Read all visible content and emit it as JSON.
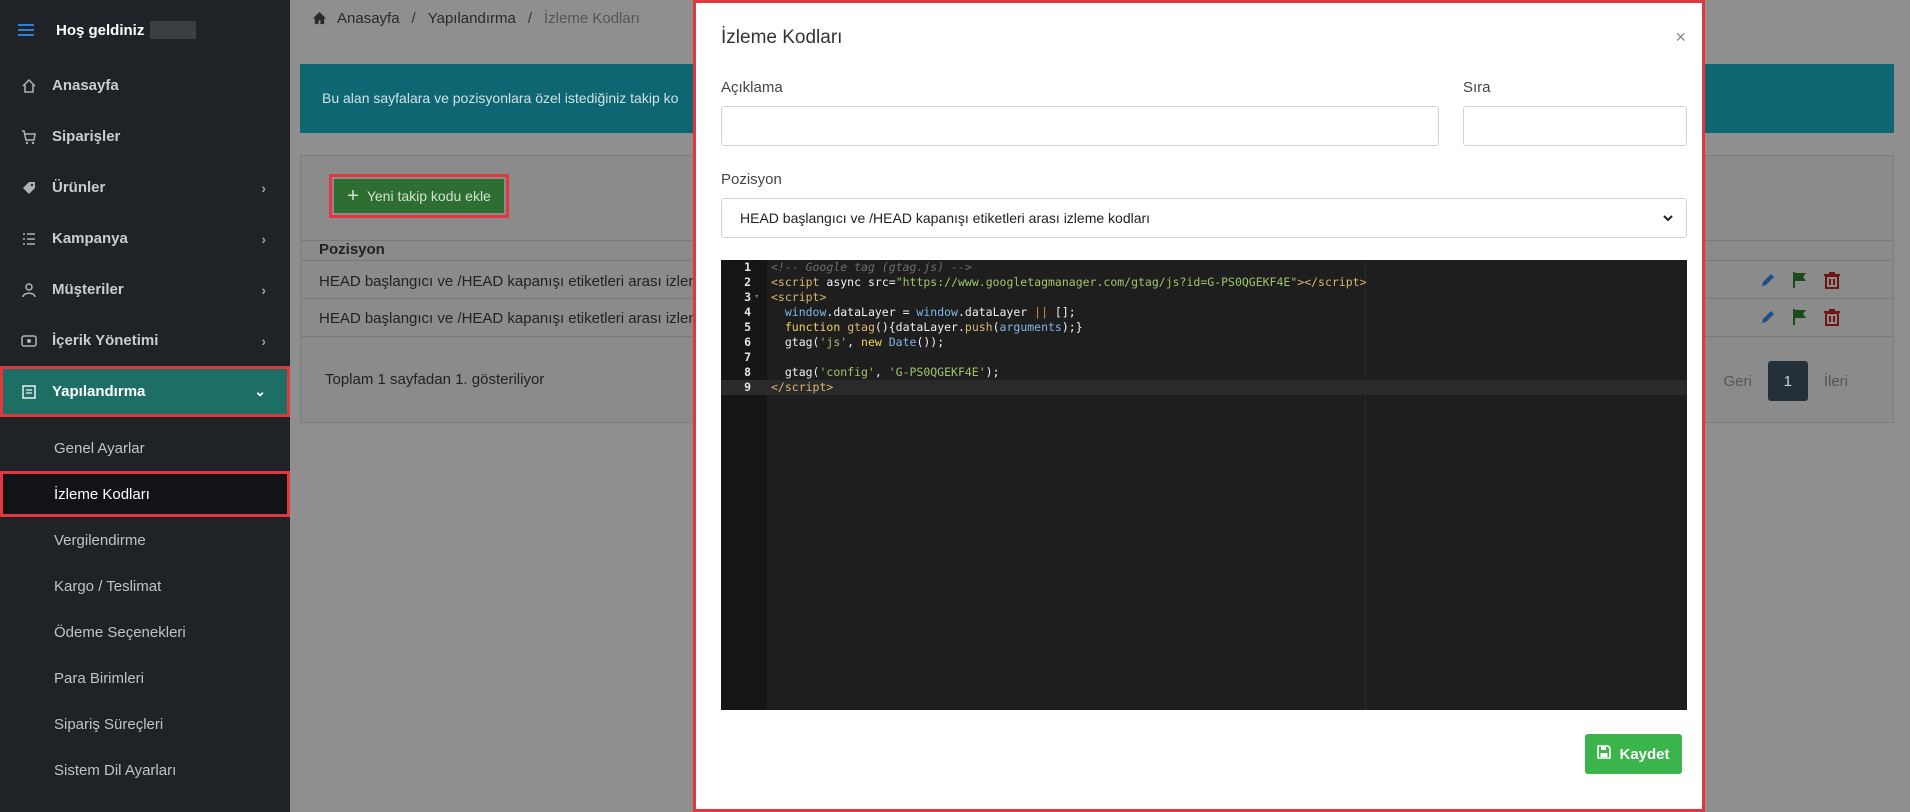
{
  "sidebar": {
    "greeting": "Hoş geldiniz",
    "items": [
      {
        "label": "Anasayfa",
        "icon": "home-icon"
      },
      {
        "label": "Siparişler",
        "icon": "cart-icon"
      },
      {
        "label": "Ürünler",
        "icon": "tag-icon"
      },
      {
        "label": "Kampanya",
        "icon": "list-icon"
      },
      {
        "label": "Müşteriler",
        "icon": "user-icon"
      },
      {
        "label": "İçerik Yönetimi",
        "icon": "eye-icon"
      },
      {
        "label": "Yapılandırma",
        "icon": "settings-icon"
      }
    ],
    "sub_items": [
      "Genel Ayarlar",
      "İzleme Kodları",
      "Vergilendirme",
      "Kargo / Teslimat",
      "Ödeme Seçenekleri",
      "Para Birimleri",
      "Sipariş Süreçleri",
      "Sistem Dil Ayarları"
    ]
  },
  "breadcrumb": {
    "home": "Anasayfa",
    "section": "Yapılandırma",
    "current": "İzleme Kodları",
    "sep": "/"
  },
  "info": {
    "text": "Bu alan sayfalara ve pozisyonlara özel istediğiniz takip ko"
  },
  "list": {
    "add_label": "Yeni takip kodu ekle",
    "column": "Pozisyon",
    "rows": [
      "HEAD başlangıcı ve /HEAD kapanışı etiketleri arası izleme",
      "HEAD başlangıcı ve /HEAD kapanışı etiketleri arası izleme"
    ],
    "pager_info": "Toplam 1 sayfadan 1. gösteriliyor",
    "prev": "Geri",
    "page": "1",
    "next": "İleri"
  },
  "modal": {
    "title": "İzleme Kodları",
    "close": "×",
    "desc_label": "Açıklama",
    "desc_value": "",
    "order_label": "Sıra",
    "order_value": "",
    "position_label": "Pozisyon",
    "position_value": "HEAD başlangıcı ve /HEAD kapanışı etiketleri arası izleme kodları",
    "save_label": "Kaydet"
  },
  "colors": {
    "accent": "#1d6f65",
    "highlight": "#e2373d",
    "save": "#3cb44c"
  }
}
